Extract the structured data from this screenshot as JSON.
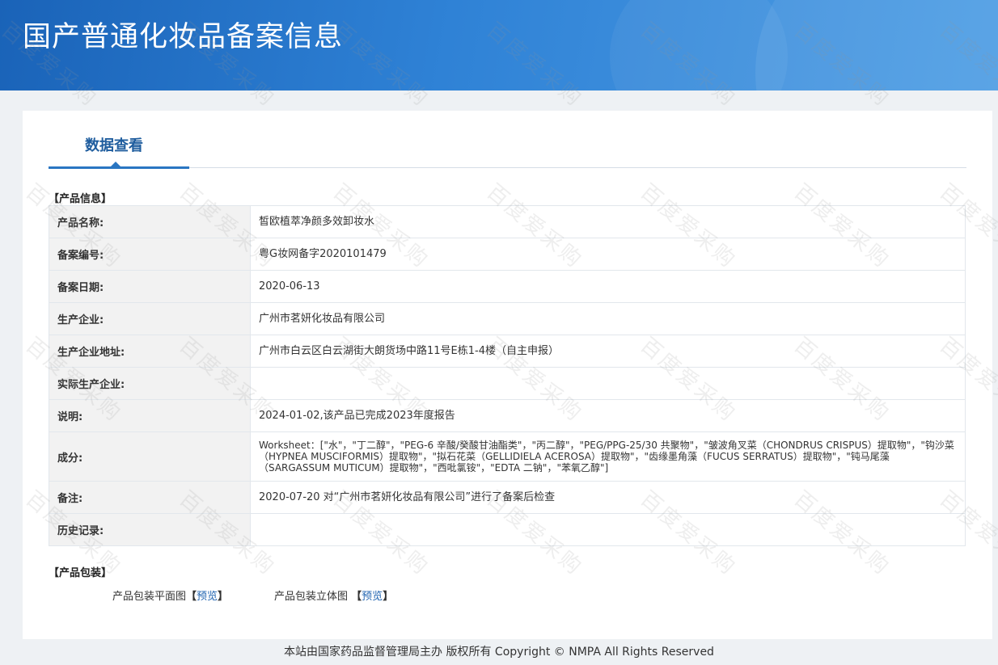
{
  "header": {
    "title": "国产普通化妆品备案信息"
  },
  "tab": {
    "label": "数据查看"
  },
  "product_info": {
    "section_title": "【产品信息】",
    "rows": [
      {
        "label": "产品名称:",
        "value": "皙欧植萃净颜多效卸妆水"
      },
      {
        "label": "备案编号:",
        "value": "粤G妆网备字2020101479"
      },
      {
        "label": "备案日期:",
        "value": "2020-06-13"
      },
      {
        "label": "生产企业:",
        "value": "广州市茗妍化妆品有限公司"
      },
      {
        "label": "生产企业地址:",
        "value": "广州市白云区白云湖街大朗货场中路11号E栋1-4楼（自主申报）"
      },
      {
        "label": "实际生产企业:",
        "value": ""
      },
      {
        "label": "说明:",
        "value": "2024-01-02,该产品已完成2023年度报告"
      },
      {
        "label": "成分:",
        "value": "Worksheet：[\"水\"，\"丁二醇\"，\"PEG-6 辛酸/癸酸甘油酯类\"，\"丙二醇\"，\"PEG/PPG-25/30 共聚物\"，\"皱波角叉菜（CHONDRUS CRISPUS）提取物\"，\"钩沙菜（HYPNEA MUSCIFORMIS）提取物\"，\"拟石花菜（GELLIDIELA ACEROSA）提取物\"，\"齿缘墨角藻（FUCUS SERRATUS）提取物\"，\"钝马尾藻（SARGASSUM MUTICUM）提取物\"，\"西吡氯铵\"，\"EDTA 二钠\"，\"苯氧乙醇\"]"
      },
      {
        "label": "备注:",
        "value": "2020-07-20 对“广州市茗妍化妆品有限公司”进行了备案后检查"
      },
      {
        "label": "历史记录:",
        "value": ""
      }
    ]
  },
  "packaging": {
    "section_title": "【产品包装】",
    "items": [
      {
        "label": "产品包装平面图",
        "bracket_open": "【",
        "link": "预览",
        "bracket_close": "】"
      },
      {
        "label": "产品包装立体图",
        "bracket_open": "【",
        "link": "预览",
        "bracket_close": "】"
      }
    ]
  },
  "footer": {
    "text": "本站由国家药品监督管理局主办 版权所有 Copyright © NMPA All Rights Reserved"
  },
  "watermark": {
    "text": "百度爱采购"
  }
}
